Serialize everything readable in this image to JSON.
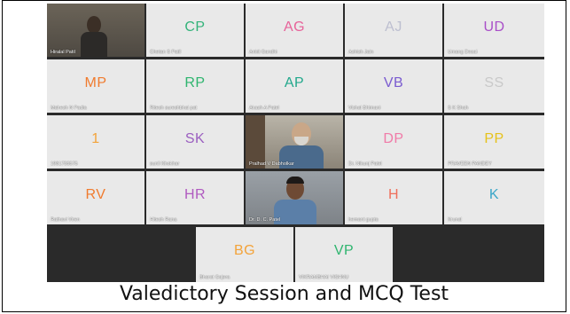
{
  "caption": "Valedictory Session and  MCQ Test",
  "participants": [
    {
      "initials": "",
      "name": "Hiralal Patil",
      "video": true
    },
    {
      "initials": "CP",
      "name": "Chetan S Patil",
      "color": "#33b37a"
    },
    {
      "initials": "AG",
      "name": "Ankit Gandhi",
      "color": "#e7639a"
    },
    {
      "initials": "AJ",
      "name": "Ashish Jain",
      "color": "#bdbfd0"
    },
    {
      "initials": "UD",
      "name": "Umang Desai",
      "color": "#a94fc8"
    },
    {
      "initials": "MP",
      "name": "Mahesh N Padia",
      "color": "#f07b2e"
    },
    {
      "initials": "RP",
      "name": "Ritesh sureshbhai pat",
      "color": "#2fb56f"
    },
    {
      "initials": "AP",
      "name": "Akash A Patel",
      "color": "#22a88c"
    },
    {
      "initials": "VB",
      "name": "Vishal Bhimani",
      "color": "#7a5bd0"
    },
    {
      "initials": "SS",
      "name": "S K Shah",
      "color": "#c9c9c9"
    },
    {
      "initials": "1",
      "name": "1981755575",
      "color": "#f3a33a"
    },
    {
      "initials": "SK",
      "name": "sunil Khokhar",
      "color": "#9b5fc0"
    },
    {
      "initials": "",
      "name": "Pralhad V Dabholkar",
      "video": true
    },
    {
      "initials": "DP",
      "name": "Dr. Nikunj Patel",
      "color": "#f07ba8"
    },
    {
      "initials": "PP",
      "name": "PRAVEEN PANDEY",
      "color": "#e6c21c"
    },
    {
      "initials": "RV",
      "name": "Rathavi Viren",
      "color": "#f07b2e"
    },
    {
      "initials": "HR",
      "name": "Hitesh Rana",
      "color": "#b05ac0"
    },
    {
      "initials": "",
      "name": "Dr. D. C. Patel",
      "video": true
    },
    {
      "initials": "H",
      "name": "hemant gupta",
      "color": "#ef6f5b"
    },
    {
      "initials": "K",
      "name": "Krunal",
      "color": "#3aa6c8"
    },
    {
      "initials": "BG",
      "name": "Bharat Gajera",
      "color": "#f3a33a"
    },
    {
      "initials": "VP",
      "name": "VIKRAMBHAI VISHNU",
      "color": "#2fb56f"
    }
  ]
}
